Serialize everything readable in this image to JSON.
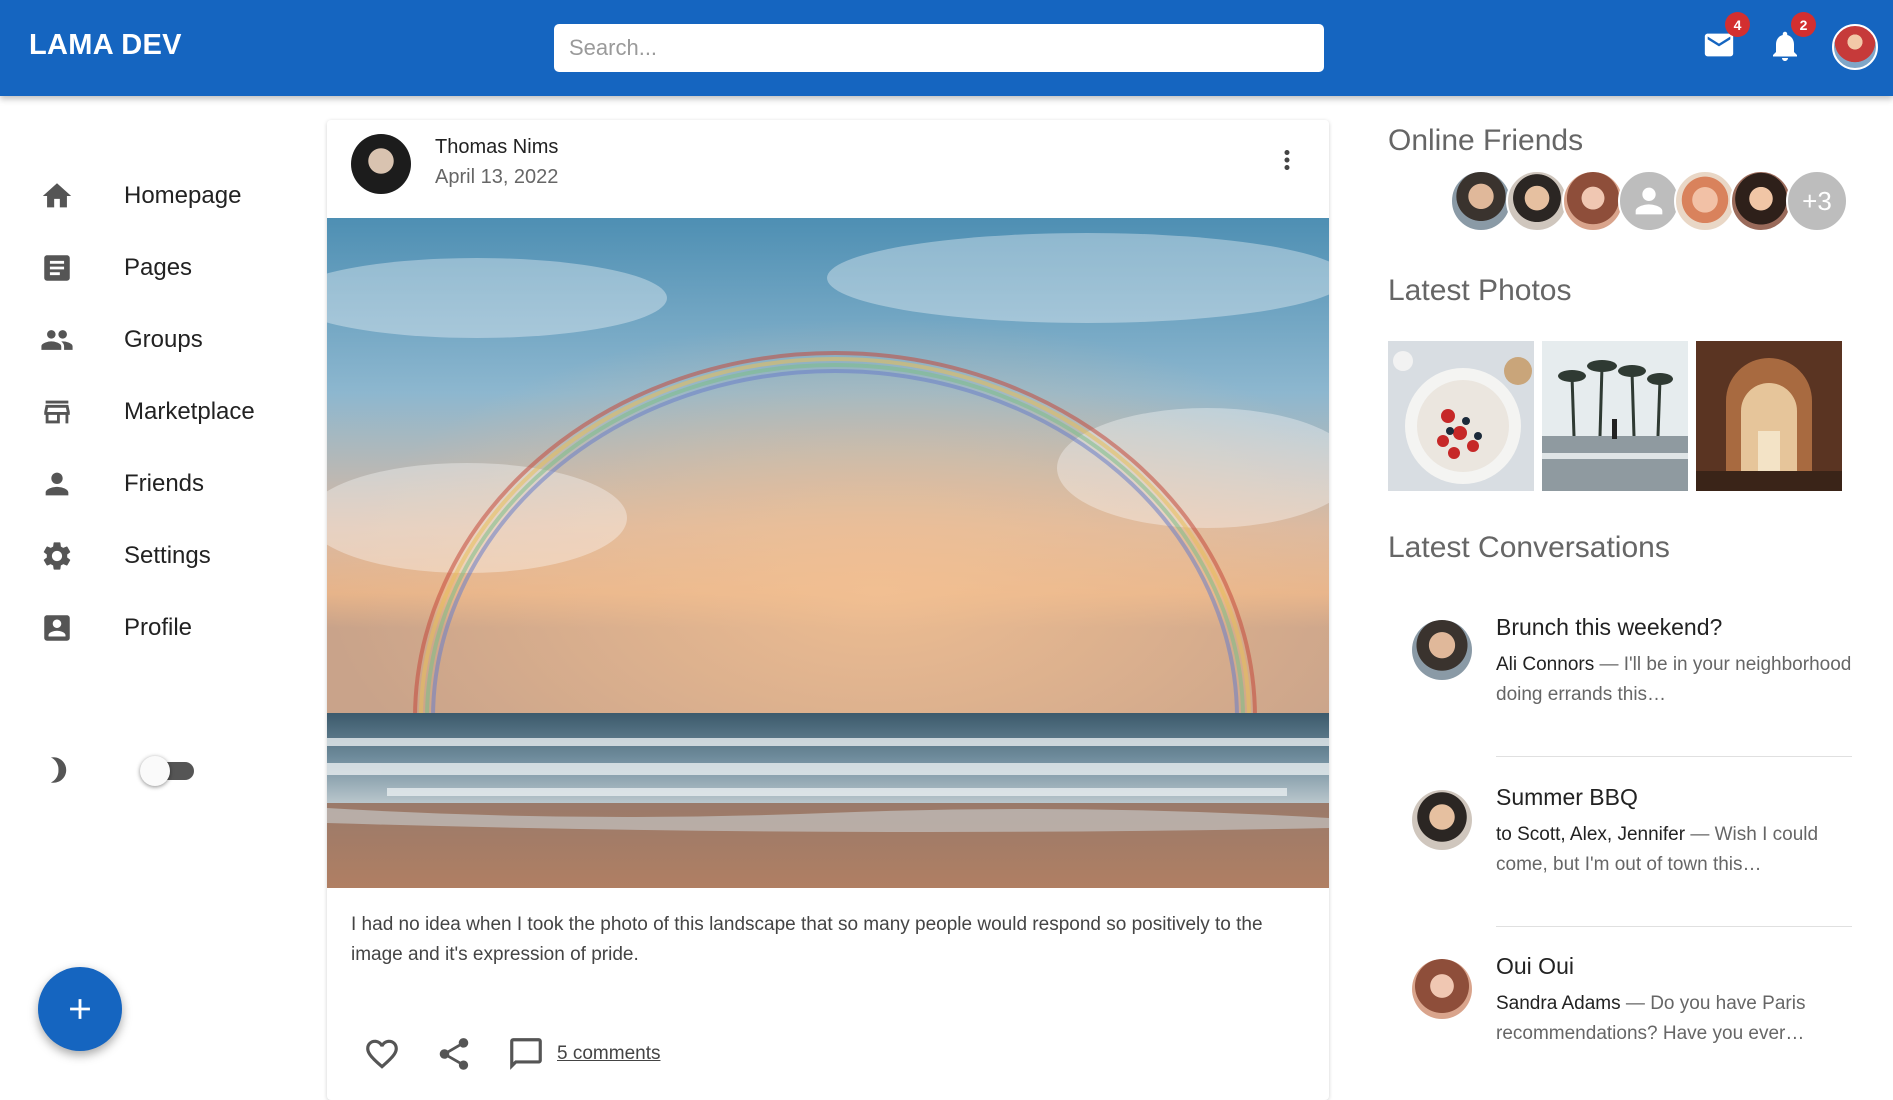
{
  "appbar": {
    "brand": "LAMA DEV",
    "search_placeholder": "Search...",
    "mail_badge": "4",
    "notifications_badge": "2",
    "colors": {
      "primary": "#1565c0",
      "badge": "#d32f2f"
    }
  },
  "sidebar": {
    "items": [
      {
        "label": "Homepage",
        "icon": "home-icon"
      },
      {
        "label": "Pages",
        "icon": "article-icon"
      },
      {
        "label": "Groups",
        "icon": "groups-icon"
      },
      {
        "label": "Marketplace",
        "icon": "storefront-icon"
      },
      {
        "label": "Friends",
        "icon": "person-icon"
      },
      {
        "label": "Settings",
        "icon": "settings-icon"
      },
      {
        "label": "Profile",
        "icon": "account-box-icon"
      }
    ],
    "theme_toggle": {
      "icon": "dark-mode-icon",
      "on": false
    },
    "fab_icon": "add-icon"
  },
  "post": {
    "author": "Thomas Nims",
    "date": "April 13, 2022",
    "text": "I had no idea when I took the photo of this landscape that so many people would respond so positively to the image and it's expression of pride.",
    "comments_label": "5 comments",
    "actions": [
      "favorite-border-icon",
      "share-icon",
      "comment-icon"
    ]
  },
  "right": {
    "online_title": "Online Friends",
    "online_more": "+3",
    "photos_title": "Latest Photos",
    "conversations_title": "Latest Conversations",
    "conversations": [
      {
        "title": "Brunch this weekend?",
        "from": "Ali Connors",
        "preview": " — I'll be in your neighborhood doing errands this…"
      },
      {
        "title": "Summer BBQ",
        "from": "to Scott, Alex, Jennifer",
        "preview": " — Wish I could come, but I'm out of town this…"
      },
      {
        "title": "Oui Oui",
        "from": "Sandra Adams",
        "preview": " — Do you have Paris recommendations? Have you ever…"
      }
    ]
  }
}
